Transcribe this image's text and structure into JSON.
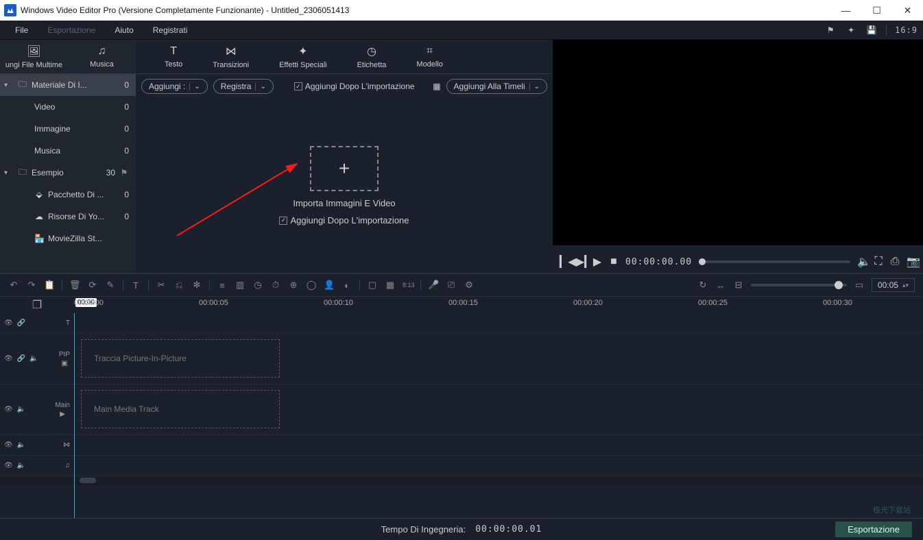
{
  "window": {
    "title": "Windows Video Editor Pro (Versione Completamente Funzionante) - Untitled_2306051413"
  },
  "menu": {
    "file": "File",
    "export": "Esportazione",
    "help": "Aiuto",
    "register": "Registrati",
    "aspect": "16:9"
  },
  "left_tabs": {
    "media": "ungi File Multime",
    "music": "Musica"
  },
  "sidebar": [
    {
      "label": "Materiale Di I...",
      "count": "0",
      "type": "folder",
      "indent": false,
      "chev": "▾",
      "active": true
    },
    {
      "label": "Video",
      "count": "0",
      "type": "plain",
      "indent": true
    },
    {
      "label": "Immagine",
      "count": "0",
      "type": "plain",
      "indent": true
    },
    {
      "label": "Musica",
      "count": "0",
      "type": "plain",
      "indent": true
    },
    {
      "label": "Esempio",
      "count": "30",
      "type": "folder",
      "indent": false,
      "chev": "▾",
      "flag": "⚑"
    },
    {
      "label": "Pacchetto Di ...",
      "count": "0",
      "type": "cube",
      "indent": true
    },
    {
      "label": "Risorse Di Yo...",
      "count": "0",
      "type": "cloud",
      "indent": true
    },
    {
      "label": "MovieZilla St...",
      "count": "",
      "type": "shop",
      "indent": true
    }
  ],
  "center_tabs": [
    {
      "label": "Testo"
    },
    {
      "label": "Transizioni"
    },
    {
      "label": "Effetti Speciali"
    },
    {
      "label": "Etichetta"
    },
    {
      "label": "Modello"
    }
  ],
  "toolrow": {
    "add": "Aggiungi :",
    "record": "Registra",
    "chk_after": "Aggiungi Dopo L'importazione",
    "grid": "▦",
    "timeline": "Aggiungi Alla Timeli"
  },
  "import": {
    "title": "Importa Immagini E Video",
    "chk": "Aggiungi Dopo L'importazione"
  },
  "preview": {
    "timecode": "00:00:00.00"
  },
  "timeline": {
    "zoom_time": "00:05",
    "play_pos": "00:00",
    "ruler": [
      "00:00:00",
      "00:00:05",
      "00:00:10",
      "00:00:15",
      "00:00:20",
      "00:00:25",
      "00:00:30"
    ],
    "pip_name": "PIP",
    "pip_placeholder": "Traccia Picture-In-Picture",
    "main_name": "Main",
    "main_placeholder": "Main Media Track"
  },
  "status": {
    "label": "Tempo Di Ingegneria:",
    "time": "00:00:00.01",
    "export": "Esportazione"
  }
}
